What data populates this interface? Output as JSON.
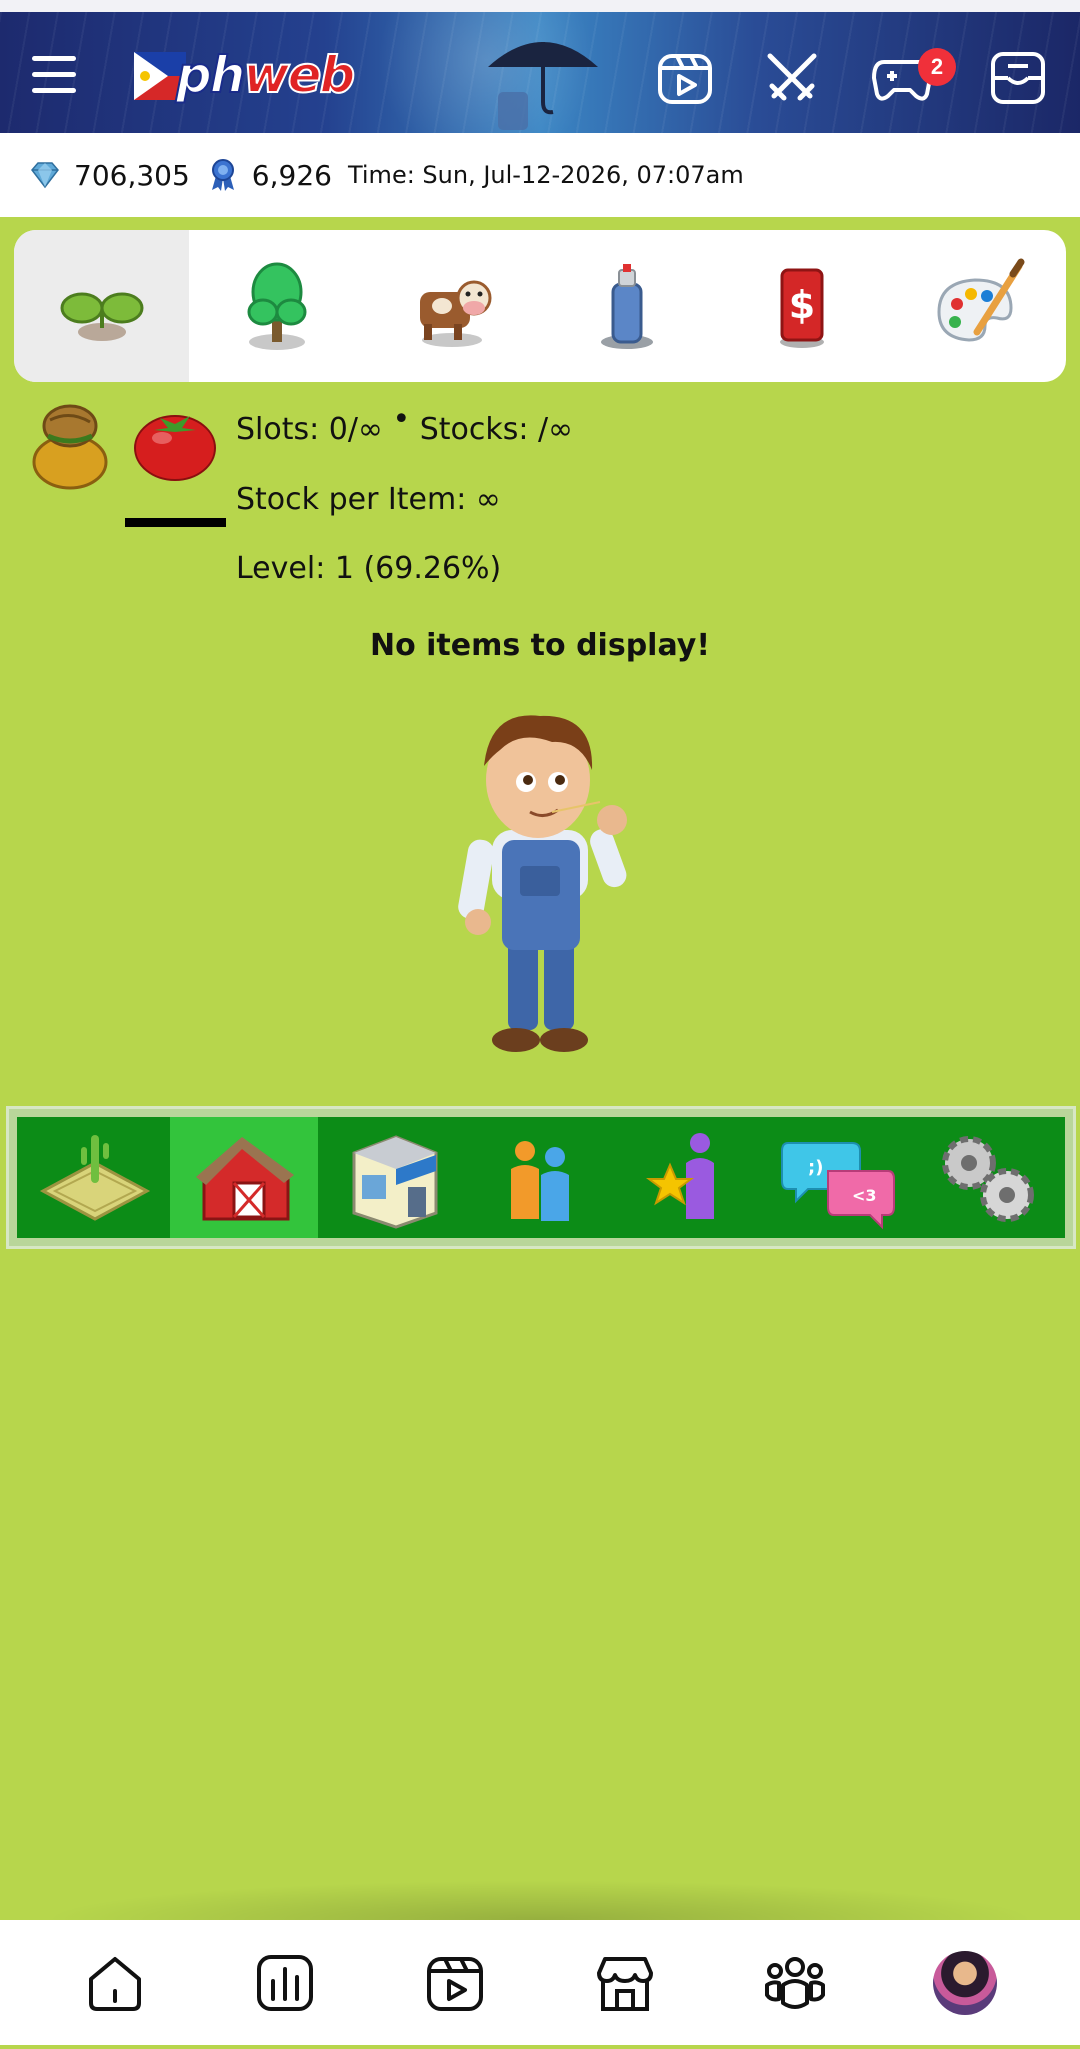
{
  "app": {
    "name": "phweb"
  },
  "header": {
    "logo_ph": "ph",
    "logo_web": "web",
    "notification_count": "2",
    "icons": [
      "menu-icon",
      "video-reels-icon",
      "battle-swords-icon",
      "game-controller-icon",
      "inbox-icon"
    ]
  },
  "stats": {
    "diamonds": "706,305",
    "ribbons": "6,926",
    "time": "Time: Sun, Jul-12-2026, 07:07am"
  },
  "categories": [
    {
      "name": "seeds",
      "icon": "sprout-icon",
      "active": true
    },
    {
      "name": "trees",
      "icon": "tree-icon",
      "active": false
    },
    {
      "name": "animals",
      "icon": "cow-icon",
      "active": false
    },
    {
      "name": "spray",
      "icon": "spray-can-icon",
      "active": false
    },
    {
      "name": "cash",
      "icon": "dollar-card-icon",
      "active": false
    },
    {
      "name": "decor",
      "icon": "paint-palette-icon",
      "active": false
    }
  ],
  "storage": {
    "slots": "Slots: 0/∞",
    "separator": "•",
    "stocks": "Stocks: /∞",
    "stock_per_item": "Stock per Item: ∞",
    "level": "Level: 1 (69.26%)",
    "empty_message": "No items to display!"
  },
  "game_nav": [
    {
      "name": "farm",
      "icon": "farm-field-icon",
      "active": false
    },
    {
      "name": "barn",
      "icon": "barn-icon",
      "active": true
    },
    {
      "name": "shop",
      "icon": "shop-icon",
      "active": false
    },
    {
      "name": "neighbors",
      "icon": "people-icon",
      "active": false
    },
    {
      "name": "achievements",
      "icon": "star-person-icon",
      "active": false
    },
    {
      "name": "chat",
      "icon": "chat-bubbles-icon",
      "active": false
    },
    {
      "name": "settings",
      "icon": "gears-icon",
      "active": false
    }
  ],
  "app_nav": [
    "home-icon",
    "stats-icon",
    "reels-icon",
    "store-icon",
    "groups-icon",
    "profile-avatar"
  ],
  "colors": {
    "grass": "#b7d64c",
    "nav_green": "#0c8c17",
    "nav_active": "#33c43c",
    "badge_red": "#f0303a"
  }
}
